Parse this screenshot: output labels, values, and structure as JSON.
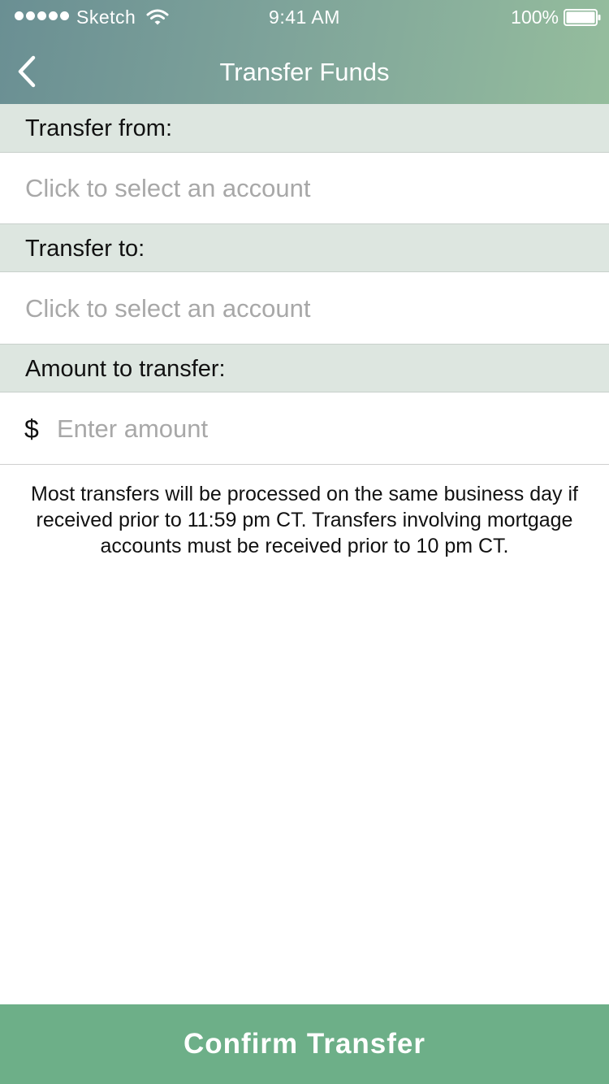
{
  "status_bar": {
    "carrier": "Sketch",
    "time": "9:41 AM",
    "battery": "100%"
  },
  "nav": {
    "title": "Transfer Funds"
  },
  "form": {
    "from_label": "Transfer from:",
    "from_placeholder": "Click to select an account",
    "to_label": "Transfer to:",
    "to_placeholder": "Click to select an account",
    "amount_label": "Amount to transfer:",
    "currency_symbol": "$",
    "amount_placeholder": "Enter amount",
    "amount_value": ""
  },
  "notice": "Most transfers will be processed on the same business day if received prior to 11:59 pm CT. Transfers involving mortgage accounts must be received prior to 10 pm CT.",
  "confirm_label": "Confirm Transfer",
  "colors": {
    "header_gradient_start": "#6a8f93",
    "header_gradient_end": "#95bd9d",
    "section_background": "#dde6e0",
    "confirm_button": "#6daf88",
    "placeholder_text": "#a8a8a8"
  },
  "icons": [
    "signal-dots-icon",
    "wifi-icon",
    "battery-icon",
    "back-chevron-icon"
  ]
}
